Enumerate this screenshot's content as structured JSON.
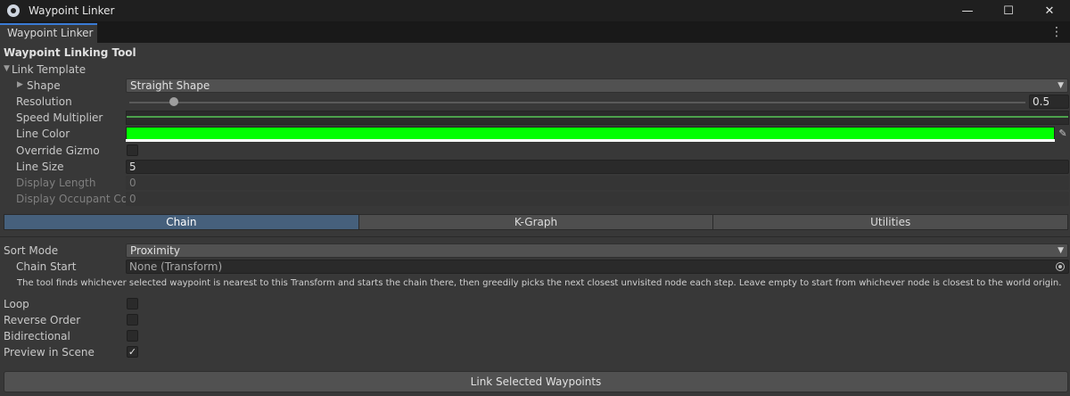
{
  "window": {
    "title": "Waypoint Linker",
    "app_icon": "unity-icon",
    "controls": {
      "minimize": "—",
      "maximize": "☐",
      "close": "✕"
    }
  },
  "tab": {
    "label": "Waypoint Linker",
    "menu_glyph": "⋮",
    "accent": "#3a7bd5"
  },
  "header": "Waypoint Linking Tool",
  "link_template": {
    "label": "Link Template",
    "shape": {
      "label": "Shape",
      "value": "Straight Shape"
    },
    "resolution": {
      "label": "Resolution",
      "value": "0.5",
      "slider_fraction": 0.05
    },
    "speed_multiplier": {
      "label": "Speed Multiplier"
    },
    "line_color": {
      "label": "Line Color",
      "color": "#00ff00"
    },
    "override_gizmo": {
      "label": "Override Gizmo",
      "checked": false
    },
    "line_size": {
      "label": "Line Size",
      "value": "5"
    },
    "display_length": {
      "label": "Display Length",
      "value": "0"
    },
    "display_occupant_count": {
      "label": "Display Occupant Coun",
      "value": "0"
    }
  },
  "mode_tabs": [
    {
      "label": "Chain",
      "active": true
    },
    {
      "label": "K-Graph",
      "active": false
    },
    {
      "label": "Utilities",
      "active": false
    }
  ],
  "sort_mode": {
    "label": "Sort Mode",
    "value": "Proximity"
  },
  "chain_start": {
    "label": "Chain Start",
    "value": "None (Transform)"
  },
  "help_text": "The tool finds whichever selected waypoint is nearest to this Transform and starts the chain there, then greedily picks the next closest unvisited node each step. Leave empty to start from whichever node is closest to the world origin.",
  "options": [
    {
      "label": "Loop",
      "checked": false
    },
    {
      "label": "Reverse Order",
      "checked": false
    },
    {
      "label": "Bidirectional",
      "checked": false
    },
    {
      "label": "Preview in Scene",
      "checked": true
    }
  ],
  "action_button": "Link Selected Waypoints"
}
